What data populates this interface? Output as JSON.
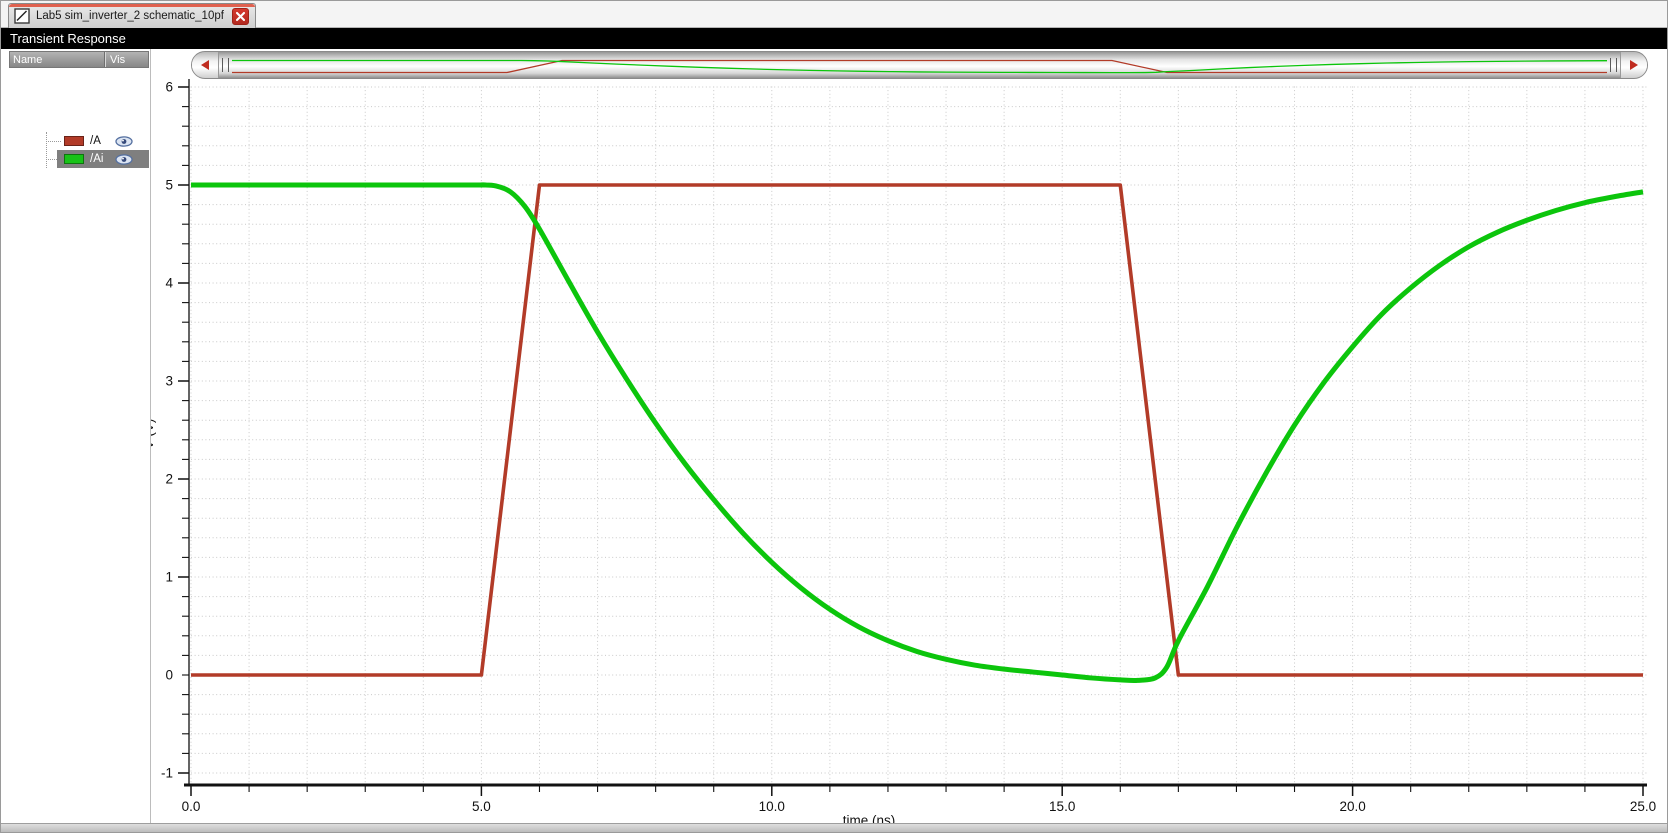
{
  "tab": {
    "title": "Lab5 sim_inverter_2 schematic_10pf"
  },
  "titlebar": {
    "title": "Transient Response"
  },
  "legend": {
    "columns": [
      "Name",
      "Vis"
    ],
    "items": [
      {
        "name": "/A",
        "color": "#b23b28",
        "selected": false,
        "visible": true
      },
      {
        "name": "/Ai",
        "color": "#17c217",
        "selected": true,
        "visible": true
      }
    ]
  },
  "ui_colors": {
    "tab_accent": "#e0614f",
    "close_button": "#d5392e",
    "selection_bg": "#7f7f7f",
    "eye_outline": "#5570a0",
    "eye_fill": "#dbe4f2",
    "arrow": "#c02c20",
    "grid": "#c9c9c9",
    "axis": "#111111"
  },
  "chart_data": {
    "type": "line",
    "title": "Transient Response",
    "xlabel": "time (ns)",
    "ylabel": "V (V)",
    "xlim": [
      0,
      25
    ],
    "ylim": [
      -1,
      6
    ],
    "x_major_ticks": [
      0,
      5,
      10,
      15,
      20,
      25
    ],
    "x_tick_labels": [
      "0.0",
      "5.0",
      "10.0",
      "15.0",
      "20.0",
      "25.0"
    ],
    "x_minor_step": 1,
    "y_major_ticks": [
      6,
      5,
      4,
      3,
      2,
      1,
      0,
      -1
    ],
    "y_tick_labels": [
      "6",
      "5",
      "4",
      "3",
      "2",
      "1",
      "0",
      "-1"
    ],
    "y_minor_step": 0.2,
    "grid": {
      "style": "dotted",
      "x_step": 1,
      "y_step": 0.2
    },
    "legend_position": "left-panel",
    "series": [
      {
        "name": "/A",
        "color": "#b23b28",
        "width": 3.6,
        "smooth": false,
        "points": [
          [
            0,
            0
          ],
          [
            5,
            0
          ],
          [
            6,
            5
          ],
          [
            16,
            5
          ],
          [
            17,
            0
          ],
          [
            25,
            0
          ]
        ]
      },
      {
        "name": "/Ai",
        "color": "#0cc50c",
        "width": 5,
        "smooth": true,
        "points": [
          [
            0,
            5
          ],
          [
            4.6,
            5
          ],
          [
            5,
            5
          ],
          [
            5.25,
            4.99
          ],
          [
            5.5,
            4.93
          ],
          [
            5.75,
            4.78
          ],
          [
            6,
            4.55
          ],
          [
            6.5,
            4.02
          ],
          [
            7,
            3.5
          ],
          [
            7.5,
            3.02
          ],
          [
            8,
            2.57
          ],
          [
            8.5,
            2.16
          ],
          [
            9,
            1.79
          ],
          [
            9.5,
            1.45
          ],
          [
            10,
            1.15
          ],
          [
            10.5,
            0.89
          ],
          [
            11,
            0.67
          ],
          [
            11.5,
            0.49
          ],
          [
            12,
            0.35
          ],
          [
            12.5,
            0.24
          ],
          [
            13,
            0.16
          ],
          [
            13.5,
            0.1
          ],
          [
            14,
            0.06
          ],
          [
            14.5,
            0.03
          ],
          [
            15,
            0.0
          ],
          [
            15.5,
            -0.03
          ],
          [
            16,
            -0.05
          ],
          [
            16.3,
            -0.055
          ],
          [
            16.6,
            -0.03
          ],
          [
            16.8,
            0.08
          ],
          [
            17,
            0.35
          ],
          [
            17.5,
            0.9
          ],
          [
            18,
            1.5
          ],
          [
            18.5,
            2.05
          ],
          [
            19,
            2.55
          ],
          [
            19.5,
            2.98
          ],
          [
            20,
            3.35
          ],
          [
            20.5,
            3.68
          ],
          [
            21,
            3.95
          ],
          [
            21.5,
            4.18
          ],
          [
            22,
            4.37
          ],
          [
            22.5,
            4.52
          ],
          [
            23,
            4.64
          ],
          [
            23.5,
            4.74
          ],
          [
            24,
            4.82
          ],
          [
            24.5,
            4.88
          ],
          [
            25,
            4.93
          ]
        ]
      }
    ]
  }
}
